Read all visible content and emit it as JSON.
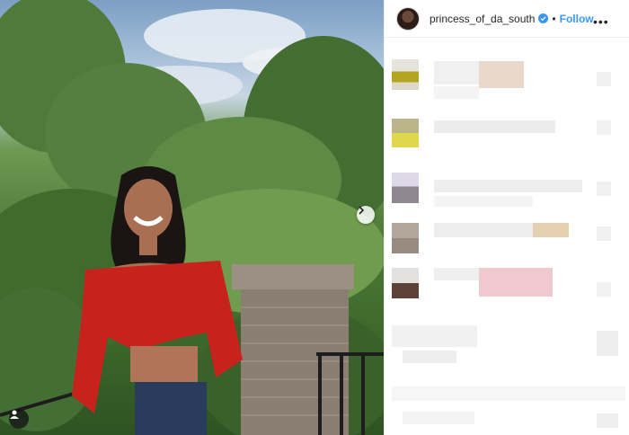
{
  "post": {
    "username": "princess_of_da_south",
    "follow_label": "Follow",
    "separator": "•",
    "more_label": "•••"
  },
  "icons": {
    "next": "chevron-right-icon",
    "tag": "user-tag-icon",
    "verified": "verified-badge-icon",
    "more": "more-options-icon"
  },
  "colors": {
    "follow": "#3897f0",
    "verified": "#3897f0",
    "text": "#262626"
  }
}
